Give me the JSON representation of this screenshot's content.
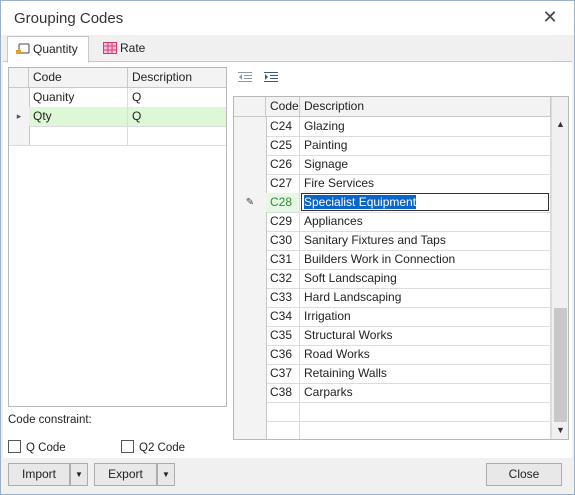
{
  "window": {
    "title": "Grouping Codes",
    "close_glyph": "✕"
  },
  "tabs": [
    {
      "label": "Quantity",
      "icon": "quantity-icon",
      "active": true
    },
    {
      "label": "Rate",
      "icon": "rate-icon",
      "active": false
    }
  ],
  "left_grid": {
    "columns": [
      "Code",
      "Description"
    ],
    "rows": [
      {
        "code": "Quanity",
        "description": "Q",
        "indicator": ""
      },
      {
        "code": "Qty",
        "description": "Q",
        "indicator": "▸"
      },
      {
        "code": "",
        "description": "",
        "indicator": ""
      }
    ]
  },
  "constraint": {
    "label": "Code constraint:",
    "options": [
      {
        "label": "Q Code",
        "checked": false
      },
      {
        "label": "Q2 Code",
        "checked": false
      }
    ]
  },
  "right_toolbar": {
    "icons": [
      "outdent-icon",
      "indent-icon"
    ]
  },
  "right_grid": {
    "columns": [
      "Code",
      "Description"
    ],
    "rows": [
      {
        "code": "C24",
        "description": "Glazing"
      },
      {
        "code": "C25",
        "description": "Painting"
      },
      {
        "code": "C26",
        "description": "Signage"
      },
      {
        "code": "C27",
        "description": "Fire Services"
      },
      {
        "code": "C28",
        "description": "Specialist Equipment",
        "editing": true,
        "indicator": "✎"
      },
      {
        "code": "C29",
        "description": "Appliances"
      },
      {
        "code": "C30",
        "description": "Sanitary Fixtures and Taps"
      },
      {
        "code": "C31",
        "description": "Builders Work in Connection"
      },
      {
        "code": "C32",
        "description": "Soft Landscaping"
      },
      {
        "code": "C33",
        "description": "Hard Landscaping"
      },
      {
        "code": "C34",
        "description": "Irrigation"
      },
      {
        "code": "C35",
        "description": "Structural Works"
      },
      {
        "code": "C36",
        "description": "Road Works"
      },
      {
        "code": "C37",
        "description": "Retaining Walls"
      },
      {
        "code": "C38",
        "description": "Carparks"
      },
      {
        "code": "",
        "description": ""
      },
      {
        "code": "",
        "description": ""
      }
    ]
  },
  "buttons": {
    "import": "Import",
    "export": "Export",
    "close": "Close",
    "dropdown_glyph": "▼"
  },
  "colors": {
    "selected_row": "#ddf7d7",
    "text_selection": "#0a66c8",
    "focus_code": "#2e8b2e"
  }
}
